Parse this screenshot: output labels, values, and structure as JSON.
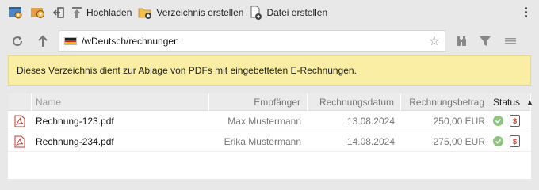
{
  "toolbar": {
    "upload_label": "Hochladen",
    "create_folder_label": "Verzeichnis erstellen",
    "create_file_label": "Datei erstellen"
  },
  "address": {
    "path": "/wDeutsch/rechnungen"
  },
  "notice": {
    "text": "Dieses Verzeichnis dient zur Ablage von PDFs mit eingebetteten E-Rechnungen."
  },
  "table": {
    "headers": {
      "name": "Name",
      "recipient": "Empfänger",
      "date": "Rechnungsdatum",
      "amount": "Rechnungsbetrag",
      "status": "Status"
    },
    "rows": [
      {
        "name": "Rechnung-123.pdf",
        "recipient": "Max Mustermann",
        "date": "13.08.2024",
        "amount": "250,00 EUR"
      },
      {
        "name": "Rechnung-234.pdf",
        "recipient": "Erika Mustermann",
        "date": "14.08.2024",
        "amount": "275,00 EUR"
      }
    ]
  },
  "colors": {
    "notice_bg": "#f9eea4",
    "status_ok": "#8fc47f",
    "pdf_red": "#c0392b"
  },
  "icons": [
    "settings-blue-icon",
    "settings-orange-icon",
    "logout-icon",
    "upload-icon",
    "new-folder-icon",
    "new-file-icon",
    "more-vertical-icon",
    "refresh-icon",
    "up-arrow-icon",
    "flag-de-icon",
    "star-icon",
    "binoculars-icon",
    "filter-icon",
    "list-view-icon",
    "pdf-file-icon",
    "check-circle-icon",
    "invoice-dollar-icon",
    "sort-asc-icon"
  ]
}
